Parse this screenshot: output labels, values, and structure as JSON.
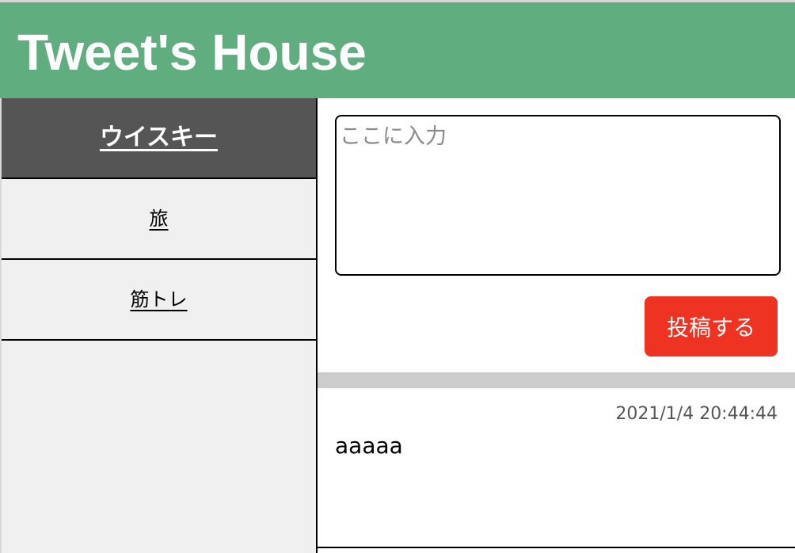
{
  "app": {
    "title": "Tweet's House"
  },
  "sidebar": {
    "items": [
      {
        "label": "ウイスキー",
        "active": true
      },
      {
        "label": "旅",
        "active": false
      },
      {
        "label": "筋トレ",
        "active": false
      }
    ]
  },
  "composer": {
    "placeholder": "ここに入力",
    "value": "",
    "submit_label": "投稿する"
  },
  "tweets": [
    {
      "timestamp": "2021/1/4 20:44:44",
      "text": "aaaaa"
    }
  ],
  "colors": {
    "header_bg": "#60ad80",
    "active_item_bg": "#555555",
    "sidebar_bg": "#f0f0f0",
    "button_bg": "#ee3322",
    "divider": "#cccccc"
  }
}
